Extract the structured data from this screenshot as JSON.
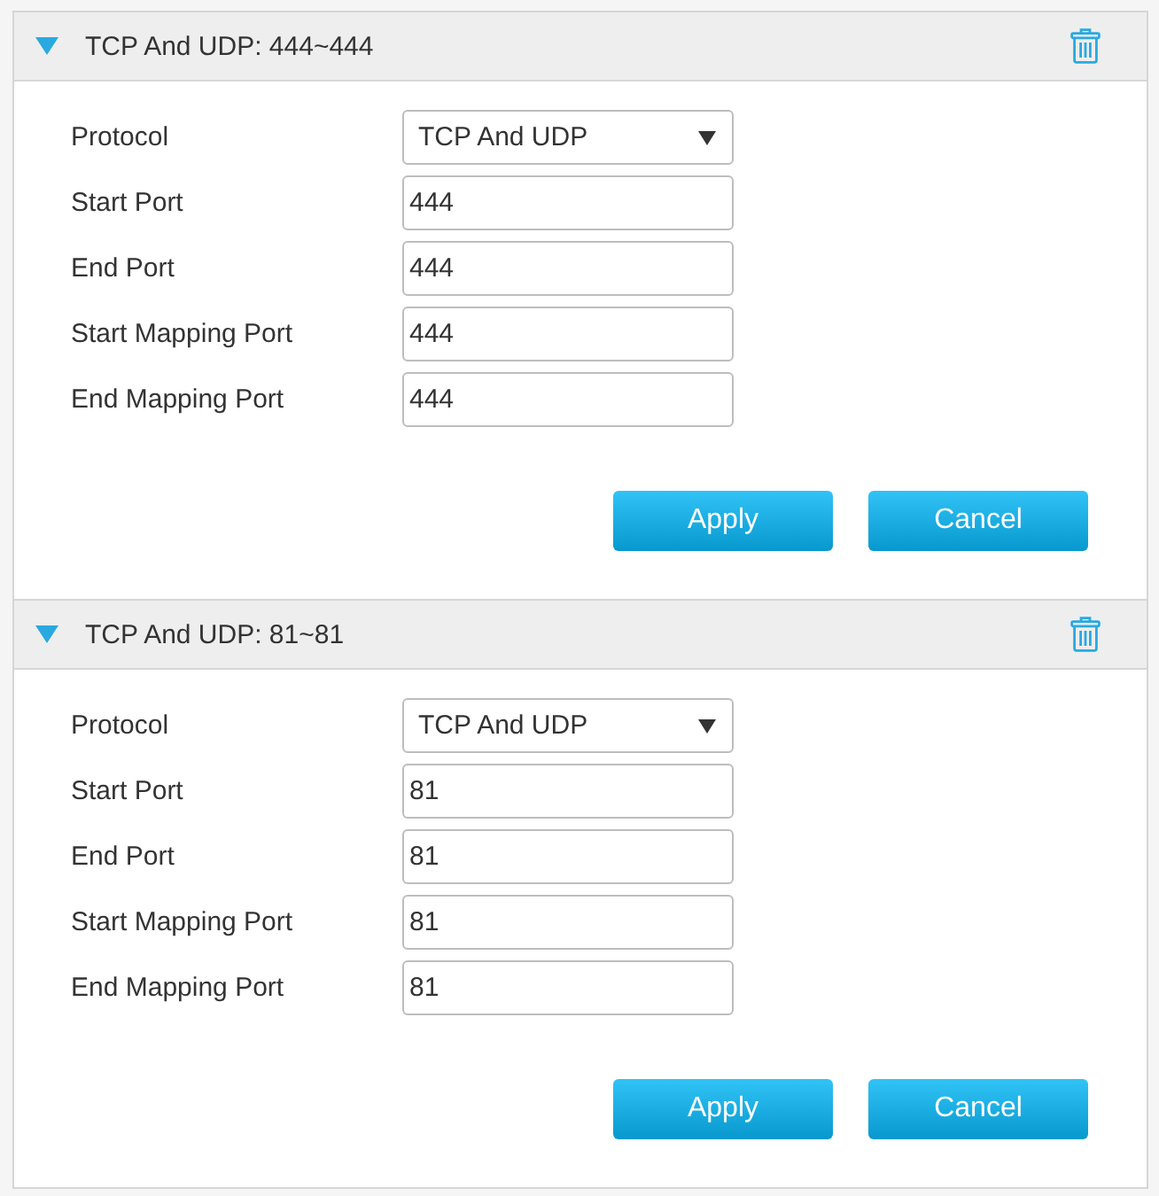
{
  "rules": [
    {
      "title": "TCP And UDP: 444~444",
      "expanded": true,
      "fields": [
        {
          "kind": "select",
          "label": "Protocol",
          "value": "TCP And UDP"
        },
        {
          "kind": "text",
          "label": "Start Port",
          "value": "444"
        },
        {
          "kind": "text",
          "label": "End Port",
          "value": "444"
        },
        {
          "kind": "text",
          "label": "Start Mapping Port",
          "value": "444"
        },
        {
          "kind": "text",
          "label": "End Mapping Port",
          "value": "444"
        }
      ],
      "buttons": [
        "Apply",
        "Cancel"
      ]
    },
    {
      "title": "TCP And UDP: 81~81",
      "expanded": true,
      "fields": [
        {
          "kind": "select",
          "label": "Protocol",
          "value": "TCP And UDP"
        },
        {
          "kind": "text",
          "label": "Start Port",
          "value": "81"
        },
        {
          "kind": "text",
          "label": "End Port",
          "value": "81"
        },
        {
          "kind": "text",
          "label": "Start Mapping Port",
          "value": "81"
        },
        {
          "kind": "text",
          "label": "End Mapping Port",
          "value": "81"
        }
      ],
      "buttons": [
        "Apply",
        "Cancel"
      ]
    }
  ]
}
